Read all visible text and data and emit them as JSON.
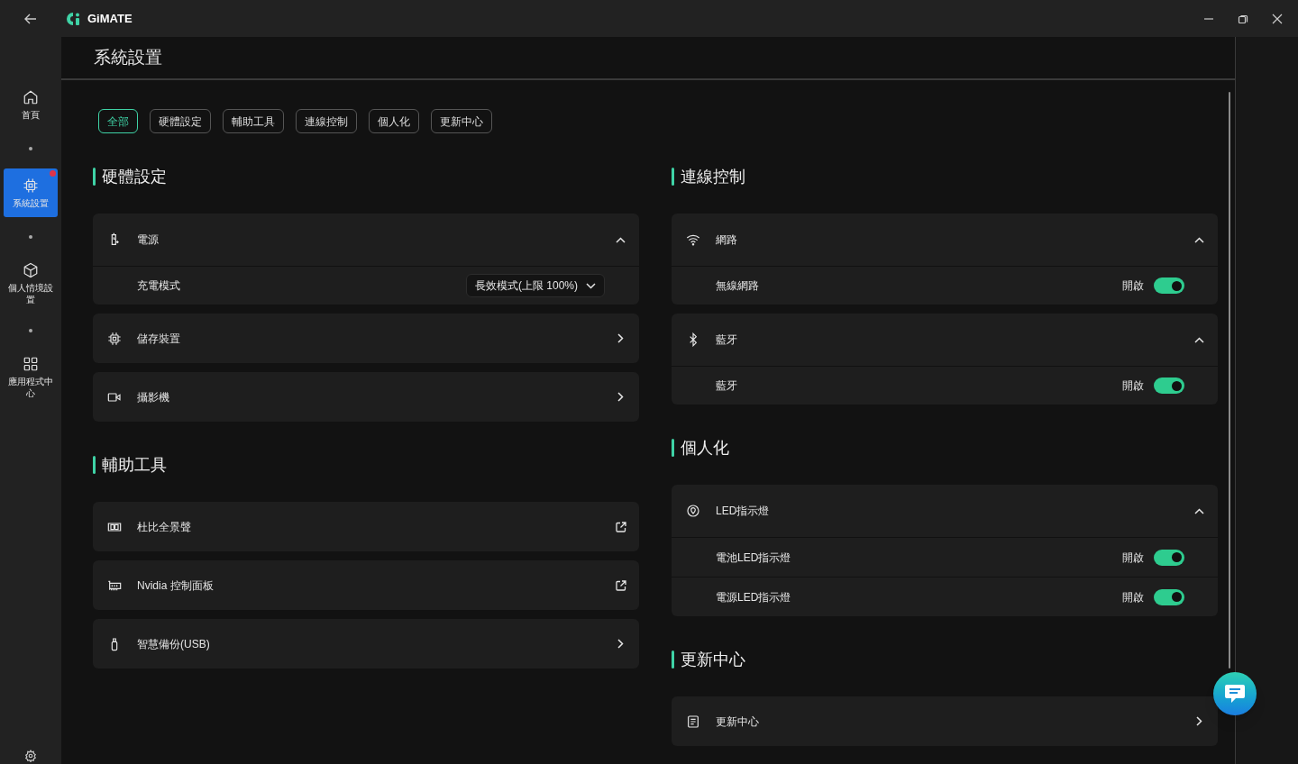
{
  "window": {
    "app_name": "GiMATE"
  },
  "sidebar": {
    "items": [
      {
        "label": "首頁",
        "selected": false,
        "notification": false
      },
      {
        "label": "系統設置",
        "selected": true,
        "notification": true
      },
      {
        "label": "個人情境設置",
        "selected": false,
        "notification": false
      },
      {
        "label": "應用程式中心",
        "selected": false,
        "notification": false
      }
    ]
  },
  "page_title": "系統設置",
  "filters": [
    {
      "label": "全部",
      "selected": true
    },
    {
      "label": "硬體設定",
      "selected": false
    },
    {
      "label": "輔助工具",
      "selected": false
    },
    {
      "label": "連線控制",
      "selected": false
    },
    {
      "label": "個人化",
      "selected": false
    },
    {
      "label": "更新中心",
      "selected": false
    }
  ],
  "columns": [
    {
      "sections": [
        {
          "title": "硬體設定",
          "cards": [
            {
              "kind": "accordion",
              "label": "電源",
              "expanded": true,
              "rows": [
                {
                  "kind": "dropdown",
                  "label": "充電模式",
                  "value": "長效模式(上限 100%)"
                }
              ]
            },
            {
              "kind": "link",
              "label": "儲存裝置"
            },
            {
              "kind": "link",
              "label": "攝影機"
            }
          ]
        },
        {
          "title": "輔助工具",
          "cards": [
            {
              "kind": "external",
              "label": "杜比全景聲"
            },
            {
              "kind": "external",
              "label": "Nvidia 控制面板"
            },
            {
              "kind": "link",
              "label": "智慧備份(USB)"
            }
          ]
        }
      ]
    },
    {
      "sections": [
        {
          "title": "連線控制",
          "cards": [
            {
              "kind": "accordion",
              "label": "網路",
              "expanded": true,
              "rows": [
                {
                  "kind": "toggle",
                  "label": "無線網路",
                  "state": "開啟",
                  "on": true
                }
              ]
            },
            {
              "kind": "accordion",
              "label": "藍牙",
              "expanded": true,
              "rows": [
                {
                  "kind": "toggle",
                  "label": "藍牙",
                  "state": "開啟",
                  "on": true
                }
              ]
            }
          ]
        },
        {
          "title": "個人化",
          "cards": [
            {
              "kind": "accordion",
              "label": "LED指示燈",
              "expanded": true,
              "rows": [
                {
                  "kind": "toggle",
                  "label": "電池LED指示燈",
                  "state": "開啟",
                  "on": true
                },
                {
                  "kind": "toggle",
                  "label": "電源LED指示燈",
                  "state": "開啟",
                  "on": true
                }
              ]
            }
          ]
        },
        {
          "title": "更新中心",
          "cards": [
            {
              "kind": "link",
              "label": "更新中心"
            }
          ]
        }
      ]
    }
  ]
}
